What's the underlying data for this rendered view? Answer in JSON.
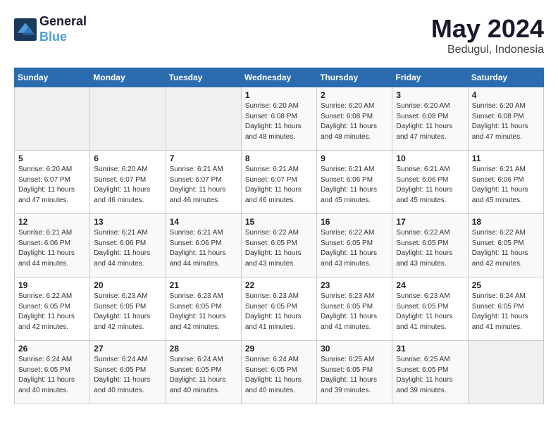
{
  "header": {
    "logo_line1": "General",
    "logo_line2": "Blue",
    "month": "May 2024",
    "location": "Bedugul, Indonesia"
  },
  "days_of_week": [
    "Sunday",
    "Monday",
    "Tuesday",
    "Wednesday",
    "Thursday",
    "Friday",
    "Saturday"
  ],
  "weeks": [
    [
      {
        "day": "",
        "info": ""
      },
      {
        "day": "",
        "info": ""
      },
      {
        "day": "",
        "info": ""
      },
      {
        "day": "1",
        "info": "Sunrise: 6:20 AM\nSunset: 6:08 PM\nDaylight: 11 hours\nand 48 minutes."
      },
      {
        "day": "2",
        "info": "Sunrise: 6:20 AM\nSunset: 6:08 PM\nDaylight: 11 hours\nand 48 minutes."
      },
      {
        "day": "3",
        "info": "Sunrise: 6:20 AM\nSunset: 6:08 PM\nDaylight: 11 hours\nand 47 minutes."
      },
      {
        "day": "4",
        "info": "Sunrise: 6:20 AM\nSunset: 6:08 PM\nDaylight: 11 hours\nand 47 minutes."
      }
    ],
    [
      {
        "day": "5",
        "info": "Sunrise: 6:20 AM\nSunset: 6:07 PM\nDaylight: 11 hours\nand 47 minutes."
      },
      {
        "day": "6",
        "info": "Sunrise: 6:20 AM\nSunset: 6:07 PM\nDaylight: 11 hours\nand 46 minutes."
      },
      {
        "day": "7",
        "info": "Sunrise: 6:21 AM\nSunset: 6:07 PM\nDaylight: 11 hours\nand 46 minutes."
      },
      {
        "day": "8",
        "info": "Sunrise: 6:21 AM\nSunset: 6:07 PM\nDaylight: 11 hours\nand 46 minutes."
      },
      {
        "day": "9",
        "info": "Sunrise: 6:21 AM\nSunset: 6:06 PM\nDaylight: 11 hours\nand 45 minutes."
      },
      {
        "day": "10",
        "info": "Sunrise: 6:21 AM\nSunset: 6:06 PM\nDaylight: 11 hours\nand 45 minutes."
      },
      {
        "day": "11",
        "info": "Sunrise: 6:21 AM\nSunset: 6:06 PM\nDaylight: 11 hours\nand 45 minutes."
      }
    ],
    [
      {
        "day": "12",
        "info": "Sunrise: 6:21 AM\nSunset: 6:06 PM\nDaylight: 11 hours\nand 44 minutes."
      },
      {
        "day": "13",
        "info": "Sunrise: 6:21 AM\nSunset: 6:06 PM\nDaylight: 11 hours\nand 44 minutes."
      },
      {
        "day": "14",
        "info": "Sunrise: 6:21 AM\nSunset: 6:06 PM\nDaylight: 11 hours\nand 44 minutes."
      },
      {
        "day": "15",
        "info": "Sunrise: 6:22 AM\nSunset: 6:05 PM\nDaylight: 11 hours\nand 43 minutes."
      },
      {
        "day": "16",
        "info": "Sunrise: 6:22 AM\nSunset: 6:05 PM\nDaylight: 11 hours\nand 43 minutes."
      },
      {
        "day": "17",
        "info": "Sunrise: 6:22 AM\nSunset: 6:05 PM\nDaylight: 11 hours\nand 43 minutes."
      },
      {
        "day": "18",
        "info": "Sunrise: 6:22 AM\nSunset: 6:05 PM\nDaylight: 11 hours\nand 42 minutes."
      }
    ],
    [
      {
        "day": "19",
        "info": "Sunrise: 6:22 AM\nSunset: 6:05 PM\nDaylight: 11 hours\nand 42 minutes."
      },
      {
        "day": "20",
        "info": "Sunrise: 6:23 AM\nSunset: 6:05 PM\nDaylight: 11 hours\nand 42 minutes."
      },
      {
        "day": "21",
        "info": "Sunrise: 6:23 AM\nSunset: 6:05 PM\nDaylight: 11 hours\nand 42 minutes."
      },
      {
        "day": "22",
        "info": "Sunrise: 6:23 AM\nSunset: 6:05 PM\nDaylight: 11 hours\nand 41 minutes."
      },
      {
        "day": "23",
        "info": "Sunrise: 6:23 AM\nSunset: 6:05 PM\nDaylight: 11 hours\nand 41 minutes."
      },
      {
        "day": "24",
        "info": "Sunrise: 6:23 AM\nSunset: 6:05 PM\nDaylight: 11 hours\nand 41 minutes."
      },
      {
        "day": "25",
        "info": "Sunrise: 6:24 AM\nSunset: 6:05 PM\nDaylight: 11 hours\nand 41 minutes."
      }
    ],
    [
      {
        "day": "26",
        "info": "Sunrise: 6:24 AM\nSunset: 6:05 PM\nDaylight: 11 hours\nand 40 minutes."
      },
      {
        "day": "27",
        "info": "Sunrise: 6:24 AM\nSunset: 6:05 PM\nDaylight: 11 hours\nand 40 minutes."
      },
      {
        "day": "28",
        "info": "Sunrise: 6:24 AM\nSunset: 6:05 PM\nDaylight: 11 hours\nand 40 minutes."
      },
      {
        "day": "29",
        "info": "Sunrise: 6:24 AM\nSunset: 6:05 PM\nDaylight: 11 hours\nand 40 minutes."
      },
      {
        "day": "30",
        "info": "Sunrise: 6:25 AM\nSunset: 6:05 PM\nDaylight: 11 hours\nand 39 minutes."
      },
      {
        "day": "31",
        "info": "Sunrise: 6:25 AM\nSunset: 6:05 PM\nDaylight: 11 hours\nand 39 minutes."
      },
      {
        "day": "",
        "info": ""
      }
    ]
  ]
}
